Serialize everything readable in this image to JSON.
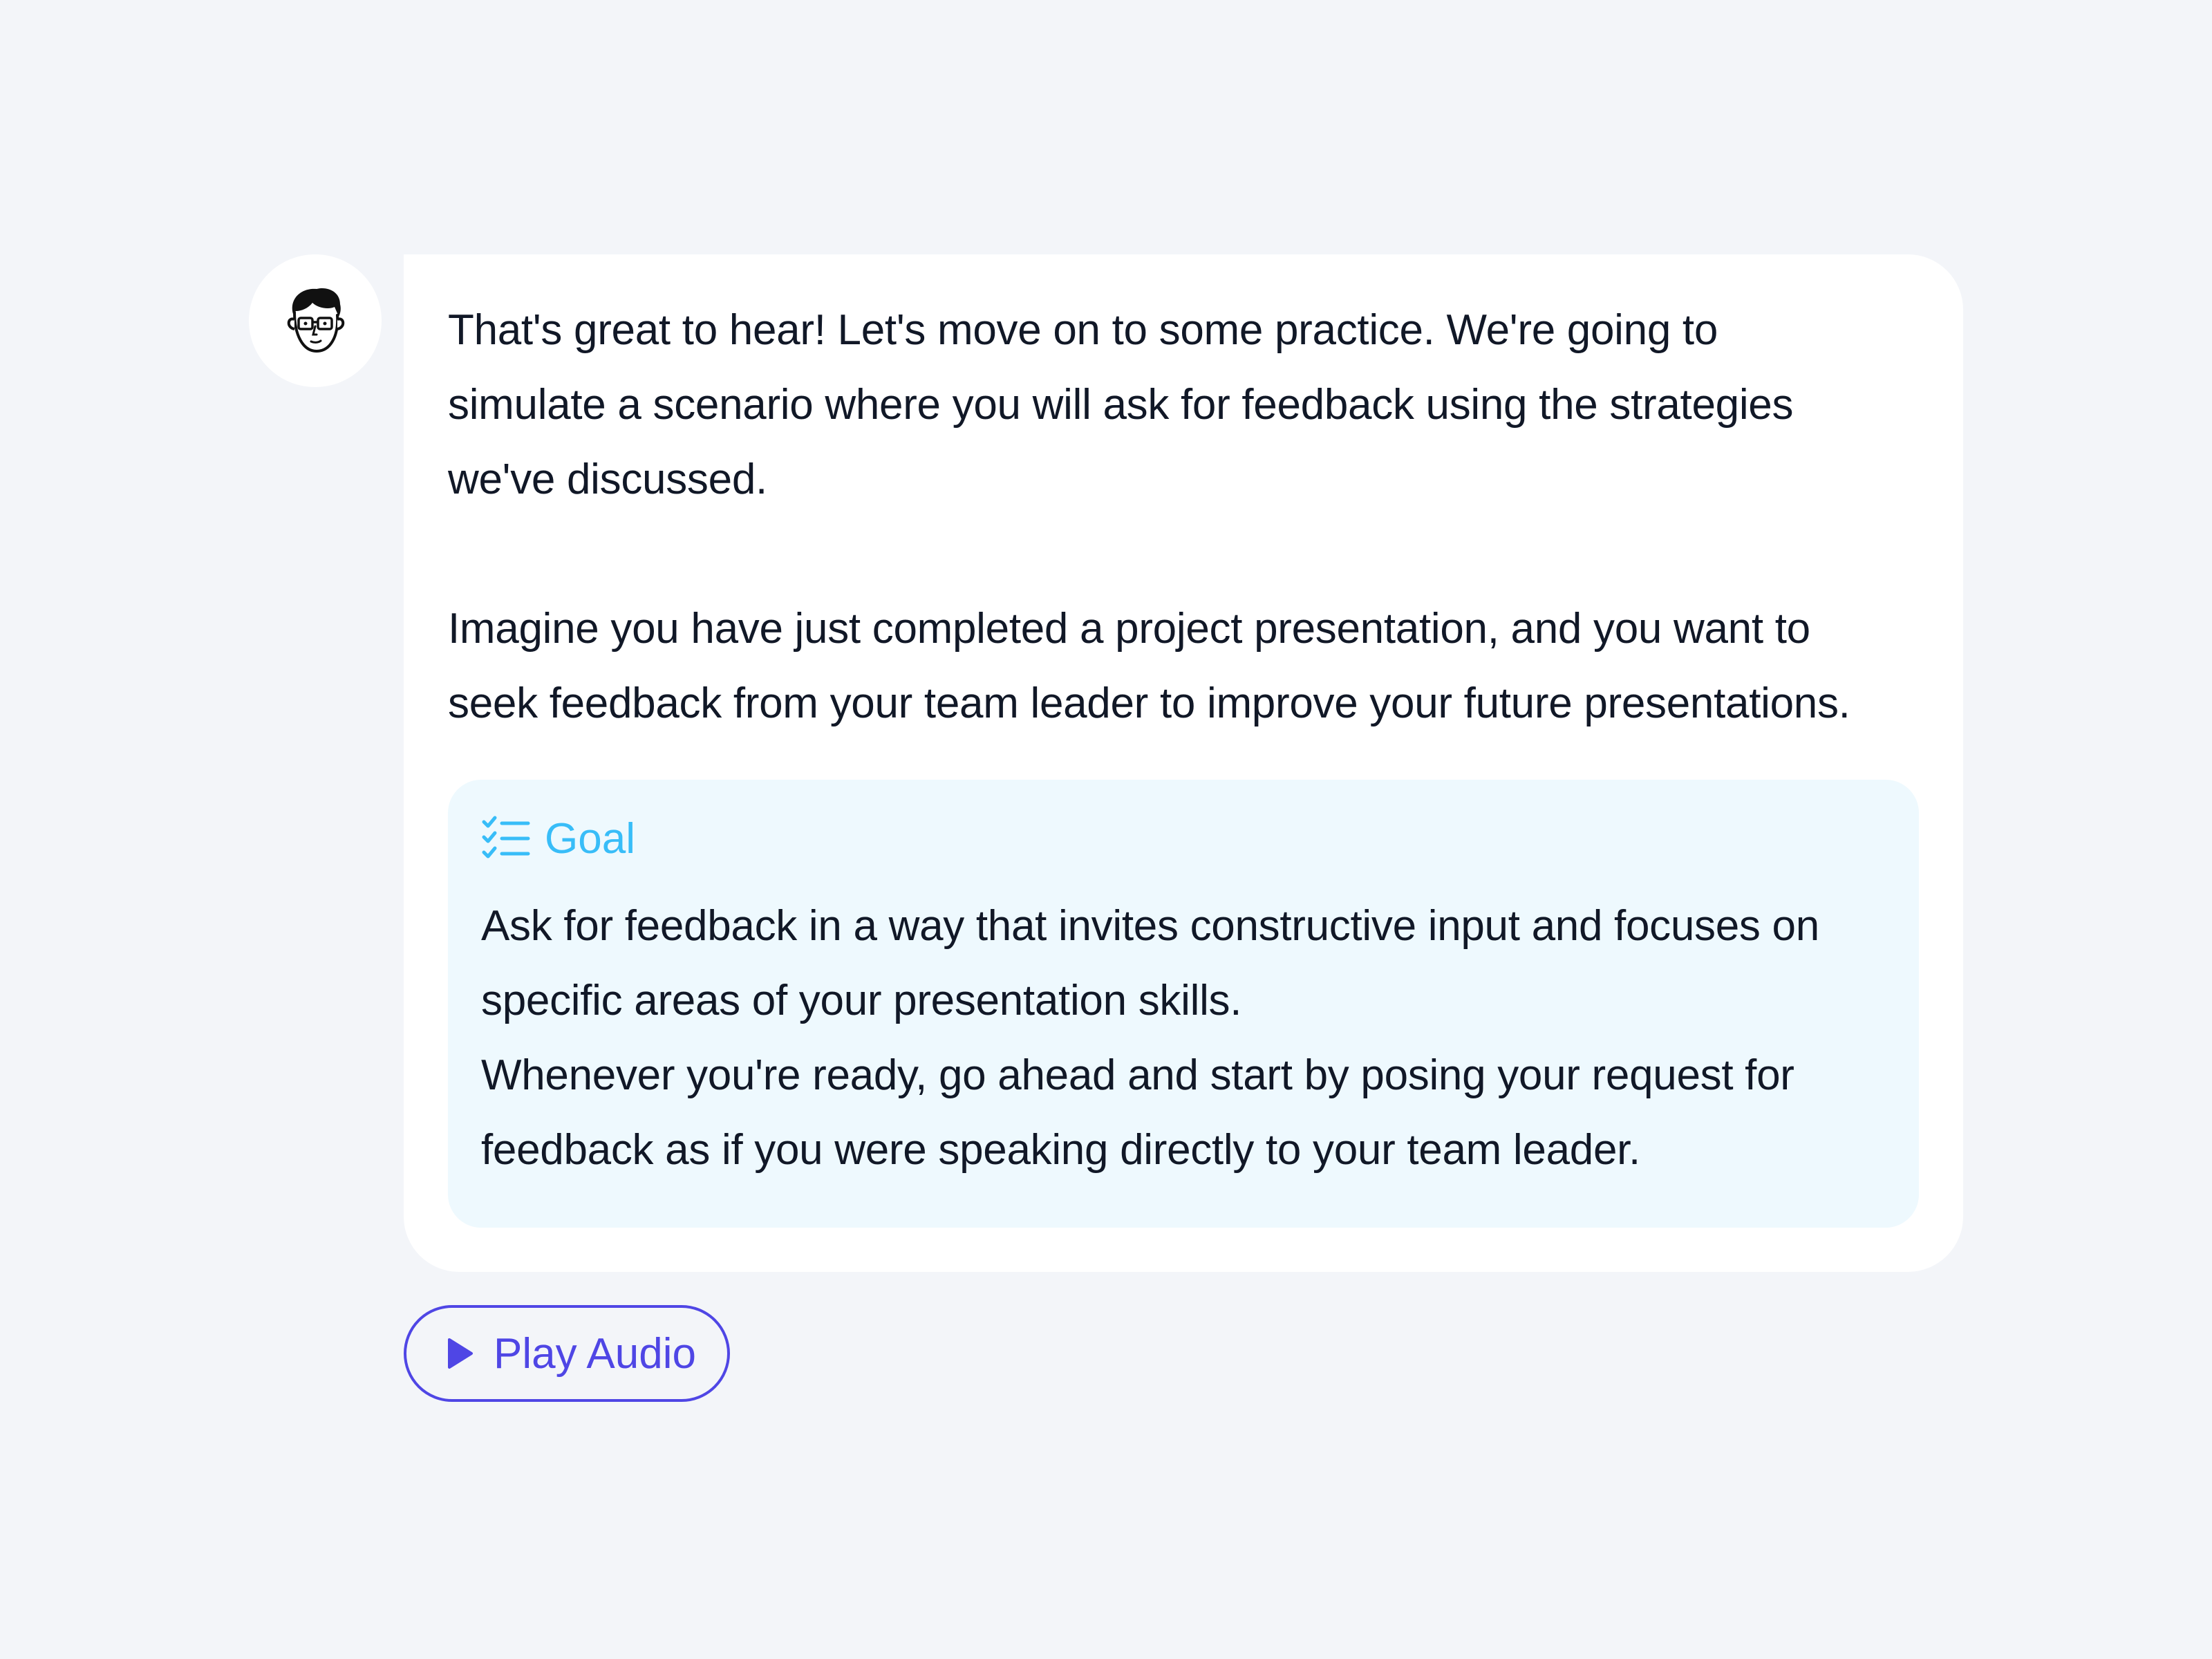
{
  "tutor": {
    "avatar_icon": "cartoon-man-with-glasses-icon"
  },
  "message": {
    "paragraph_1": "That's great to hear! Let's move on to some practice. We're going to\nsimulate a scenario where you will ask for feedback using the strategies\nwe've discussed.",
    "paragraph_2": "Imagine you have just completed a project presentation, and you want to\nseek feedback from your team leader to improve your future presentations."
  },
  "goal": {
    "icon": "checklist-icon",
    "title": "Goal",
    "text": "Ask for feedback in a way that invites constructive input and focuses on\nspecific areas of your presentation skills.\nWhenever you're ready, go ahead and start by posing your request for\nfeedback as if you were speaking directly to your team leader.",
    "accent_color": "#38bdf8",
    "background_color": "#eef9fe"
  },
  "audio": {
    "icon": "play-icon",
    "label": "Play Audio",
    "accent_color": "#4f46e5"
  }
}
